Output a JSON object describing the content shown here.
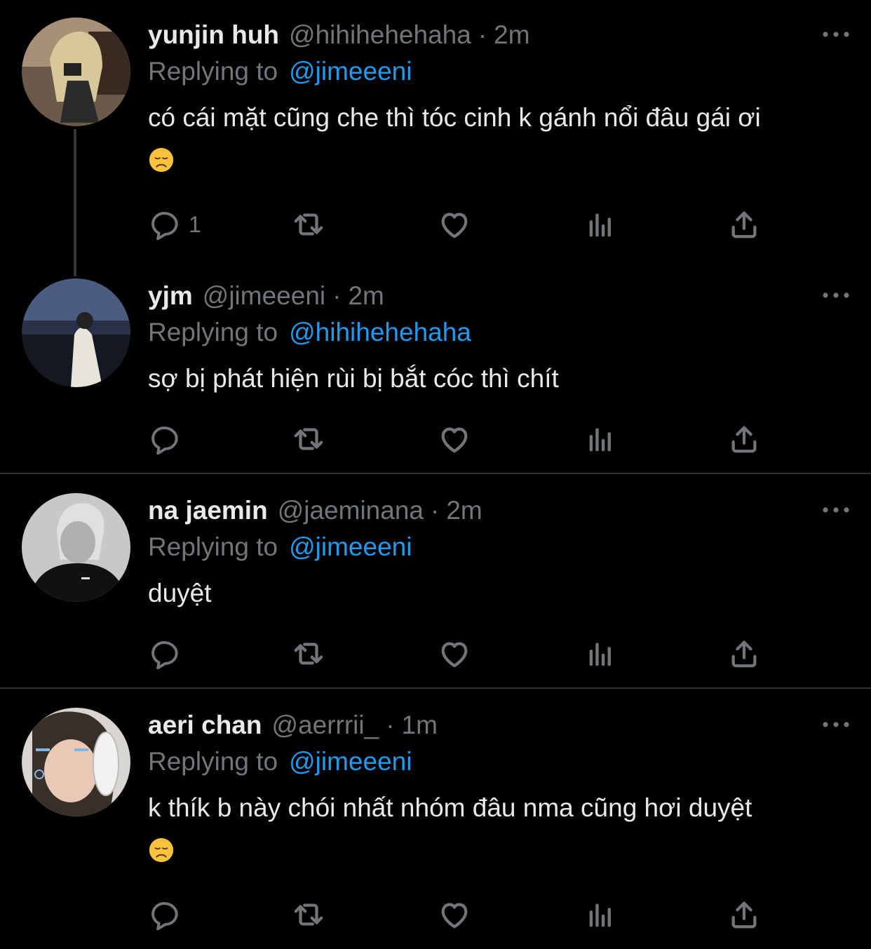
{
  "tweets": [
    {
      "name": "yunjin huh",
      "handle": "@hihihehehaha",
      "dot": "·",
      "time": "2m",
      "replying_label": "Replying to",
      "replying_to": "@jimeeeni",
      "text": "có cái mặt cũng che thì tóc cinh k gánh nổi đâu gái ơi",
      "emoji": "disappointed-face",
      "reply_count": "1"
    },
    {
      "name": "yjm",
      "handle": "@jimeeeni",
      "dot": "·",
      "time": "2m",
      "replying_label": "Replying to",
      "replying_to": "@hihihehehaha",
      "text": "sợ bị phát hiện rùi bị bắt cóc thì chít",
      "reply_count": ""
    },
    {
      "name": "na jaemin",
      "handle": "@jaeminana",
      "dot": "·",
      "time": "2m",
      "replying_label": "Replying to",
      "replying_to": "@jimeeeni",
      "text": "duyệt",
      "reply_count": ""
    },
    {
      "name": "aeri chan",
      "handle": "@aerrrii_",
      "dot": "·",
      "time": "1m",
      "replying_label": "Replying to",
      "replying_to": "@jimeeeni",
      "text": "k thík b này chói nhất nhóm đâu nma cũng hơi duyệt",
      "emoji": "disappointed-face",
      "reply_count": ""
    }
  ],
  "icons": {
    "reply": "reply-icon",
    "retweet": "retweet-icon",
    "like": "heart-icon",
    "views": "views-icon",
    "share": "share-icon",
    "more": "more-icon"
  },
  "colors": {
    "background": "#000000",
    "text": "#e7e9ea",
    "secondary": "#71767b",
    "accent": "#1d9bf0",
    "divider": "#2f3336"
  }
}
